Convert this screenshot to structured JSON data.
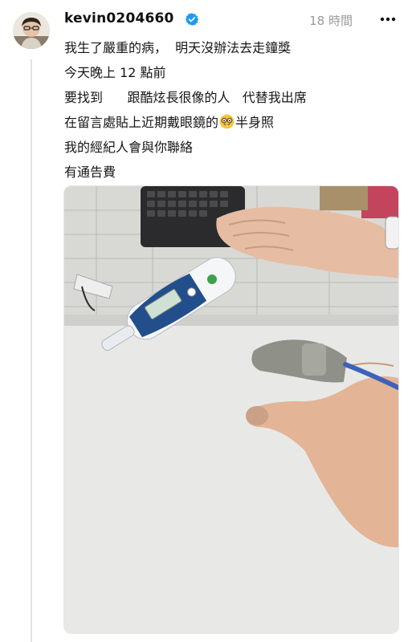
{
  "post": {
    "author": {
      "username": "kevin0204660",
      "verified_icon": "verified-badge-icon",
      "avatar_icon": "avatar"
    },
    "time": "18 時間",
    "more_icon": "more-options-icon",
    "lines": [
      "我生了嚴重的病，  明天沒辦法去走鐘獎",
      "今天晚上 12 點前",
      "要找到      跟酷炫長很像的人   代替我出席",
      "在留言處貼上近期戴眼鏡的",
      "半身照",
      "我的經紀人會與你聯絡",
      "有通告費"
    ],
    "emoji_icon": "nerd-face-emoji-icon",
    "photo": {
      "description_icon": "post-photo",
      "colors": {
        "desk": "#e7e8e6",
        "paper": "#dcdcd8",
        "skin": "#e3b79b",
        "thermometer_blue": "#2a4f8a",
        "sensor_gray": "#8f9189",
        "cable_blue": "#3d62b8"
      }
    }
  }
}
